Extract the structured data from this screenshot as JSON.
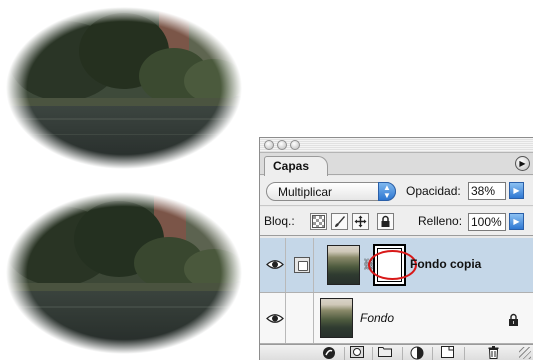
{
  "panel": {
    "tab_label": "Capas",
    "blend_mode": "Multiplicar",
    "opacity_label": "Opacidad:",
    "opacity_value": "38%",
    "lock_label": "Bloq.:",
    "fill_label": "Relleno:",
    "fill_value": "100%"
  },
  "layers": [
    {
      "name": "Fondo copia",
      "selected": true,
      "visible": true,
      "has_mask": true
    },
    {
      "name": "Fondo",
      "selected": false,
      "visible": true,
      "locked": true
    }
  ],
  "colors": {
    "selected_row": "#c5d7e8",
    "accent_blue": "#2f78d2",
    "highlight_circle": "#d81818"
  },
  "icons": {
    "panel_menu": "triangle-right-icon",
    "lock_transparency": "checker-icon",
    "lock_image": "brush-icon",
    "lock_position": "move-icon",
    "lock_all": "lock-icon",
    "bottom_bar": [
      "layer-style-icon",
      "add-mask-icon",
      "new-set-icon",
      "adjustment-layer-icon",
      "new-layer-icon",
      "trash-icon"
    ]
  }
}
